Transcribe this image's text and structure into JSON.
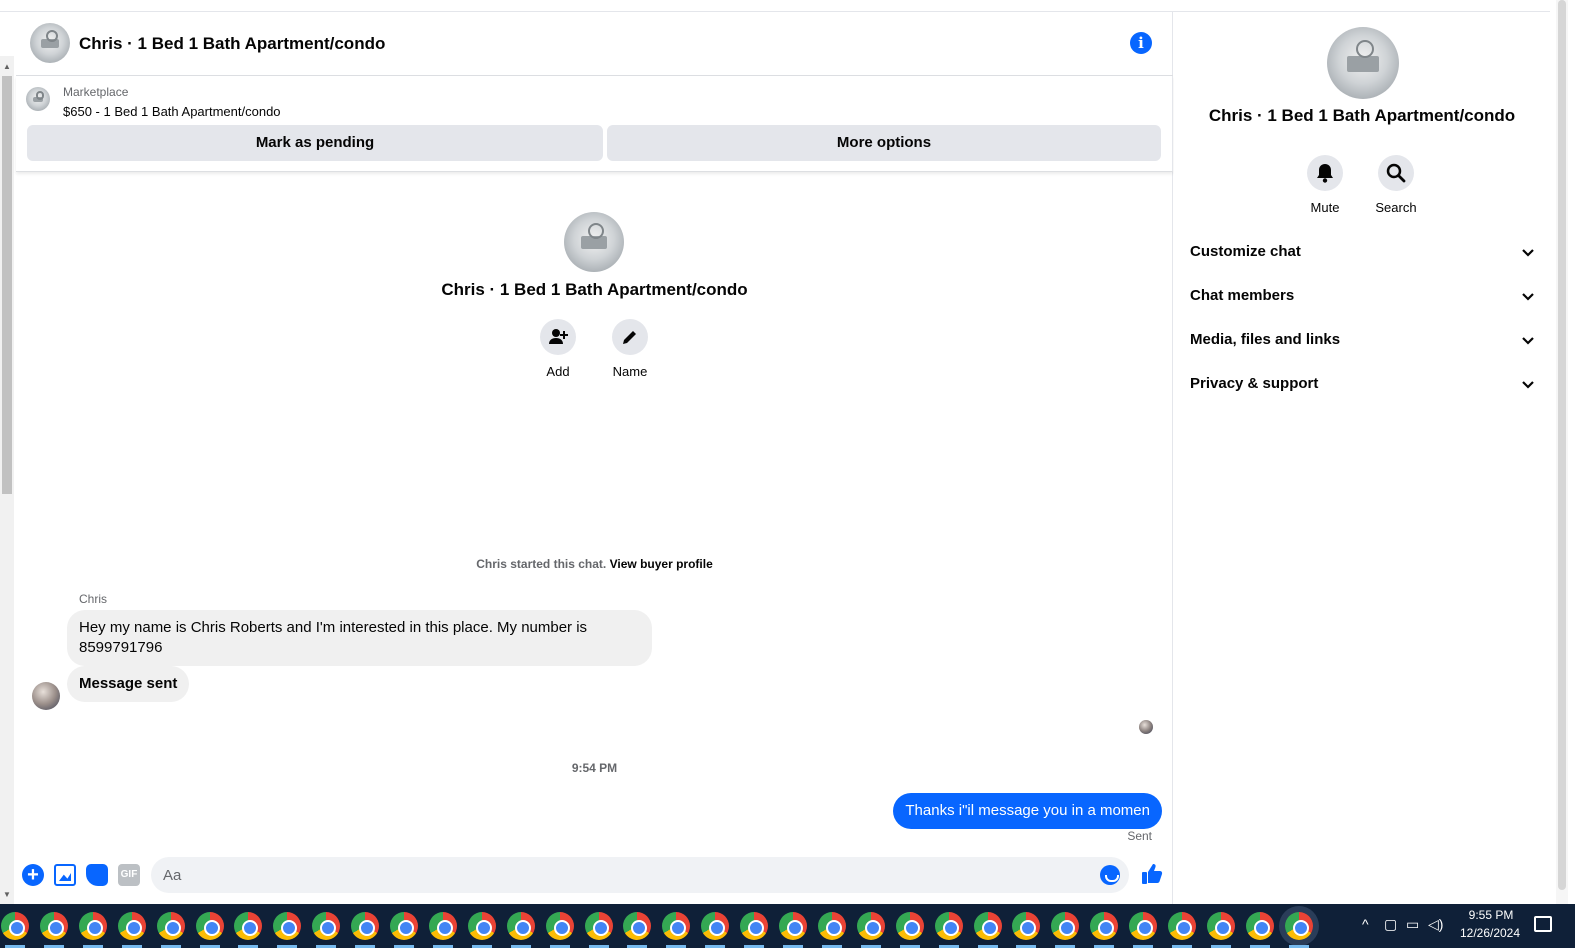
{
  "header": {
    "title": "Chris · 1 Bed 1 Bath Apartment/condo"
  },
  "marketplace": {
    "label": "Marketplace",
    "listing": "$650 - 1 Bed 1 Bath Apartment/condo",
    "mark_pending": "Mark as pending",
    "more_options": "More options"
  },
  "intro": {
    "name": "Chris · 1 Bed 1 Bath Apartment/condo",
    "add_label": "Add",
    "name_label": "Name",
    "started_text": "Chris started this chat.",
    "view_profile": "View buyer profile"
  },
  "messages": {
    "sender": "Chris",
    "incoming": [
      "Hey my name is Chris Roberts and I'm interested in this place. My number is 8599791796",
      "Message sent"
    ],
    "timestamp": "9:54 PM",
    "outgoing": "Thanks i\"il message you in a momen",
    "status": "Sent"
  },
  "composer": {
    "placeholder": "Aa",
    "gif_label": "GIF"
  },
  "panel": {
    "name": "Chris · 1 Bed 1 Bath Apartment/condo",
    "mute": "Mute",
    "search": "Search",
    "sections": [
      "Customize chat",
      "Chat members",
      "Media, files and links",
      "Privacy & support"
    ]
  },
  "taskbar": {
    "app_count": 34,
    "time": "9:55 PM",
    "date": "12/26/2024"
  },
  "colors": {
    "accent": "#0866ff",
    "bubble_in": "#f0f0f0",
    "button_gray": "#e4e6eb",
    "taskbar": "#0f2038"
  }
}
